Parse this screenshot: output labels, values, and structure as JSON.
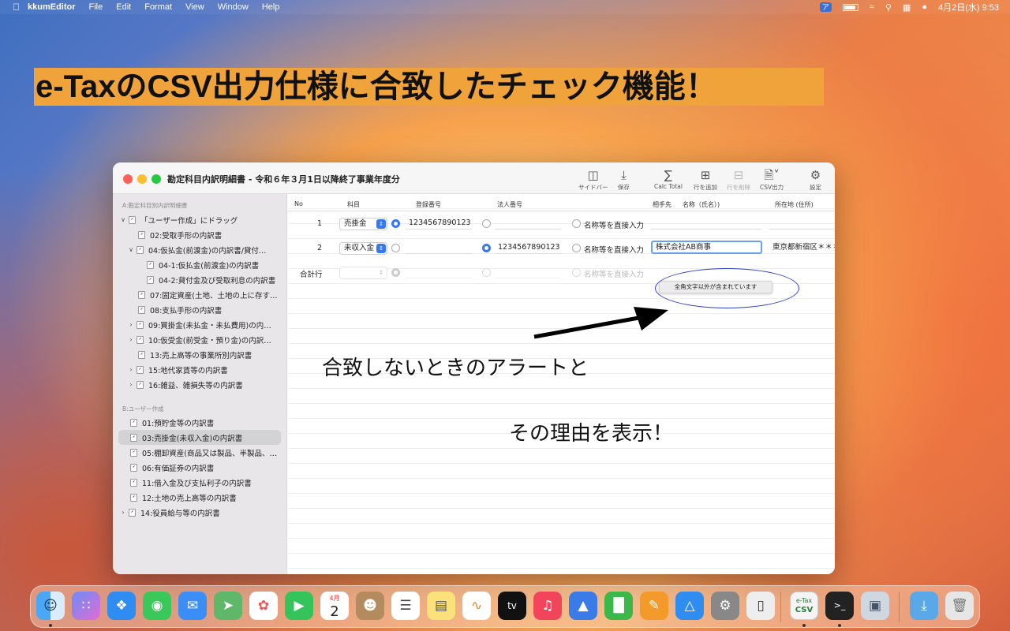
{
  "menubar": {
    "app": "kkumEditor",
    "items": [
      "File",
      "Edit",
      "Format",
      "View",
      "Window",
      "Help"
    ],
    "ime": "ア",
    "clock": "4月2日(水) 9:53"
  },
  "banner": {
    "text": "e-TaxのCSV出力仕様に合致したチェック機能！"
  },
  "window": {
    "title": "勘定科目内訳明細書 - 令和６年３月1日以降終了事業年度分",
    "toolbar": {
      "sidebar": "サイドバー",
      "save": "保存",
      "calc": "Calc Total",
      "add_row": "行を追加",
      "del_row": "行を削除",
      "csv": "CSV出力",
      "settings": "設定"
    }
  },
  "sidebar": {
    "section_a": "A:勘定科目別内訳明細書",
    "items_a": [
      "「ユーザー作成」にドラッグ",
      "02:受取手形の内訳書",
      "04:仮払金(前渡金)の内訳書/貸付…",
      "04-1:仮払金(前渡金)の内訳書",
      "04-2:貸付金及び受取利息の内訳書",
      "07:固定資産(土地、土地の上に存す…",
      "08:支払手形の内訳書",
      "09:買掛金(未払金・未払費用)の内…",
      "10:仮受金(前受金・預り金)の内訳…",
      "13:売上高等の事業所別内訳書",
      "15:地代家賃等の内訳書",
      "16:雑益、雑損失等の内訳書"
    ],
    "section_b": "B:ユーザー作成",
    "items_b": [
      "01:預貯金等の内訳書",
      "03:売掛金(未収入金)の内訳書",
      "05:棚卸資産(商品又は製品、半製品、…",
      "06:有価証券の内訳書",
      "11:借入金及び支払利子の内訳書",
      "12:土地の売上高等の内訳書",
      "14:役員給与等の内訳書"
    ]
  },
  "table": {
    "headers": {
      "no": "No",
      "kamoku": "科目",
      "reg": "登録番号",
      "corp": "法人番号",
      "aite": "相手先",
      "name": "名称（氏名）)",
      "addr": "所在地 (住所)"
    },
    "rows": [
      {
        "no": "1",
        "kamoku": "売掛金",
        "reg": "1234567890123",
        "corp": "",
        "direct": "名称等を直接入力",
        "name": "",
        "addr": ""
      },
      {
        "no": "2",
        "kamoku": "未収入金",
        "reg": "",
        "corp": "1234567890123",
        "direct": "名称等を直接入力",
        "name": "株式会社AB商事",
        "addr": "東京都新宿区＊＊＊"
      }
    ],
    "total": {
      "no": "合計行",
      "direct": "名称等を直接入力"
    },
    "tooltip": "全角文字以外が含まれています"
  },
  "annotations": {
    "line1": "合致しないときのアラートと",
    "line2": "その理由を表示！"
  },
  "dock": {
    "calendar_month": "4月",
    "calendar_day": "2",
    "tv": "tv",
    "csv_top": "e-Tax",
    "csv_bottom": "CSV"
  }
}
